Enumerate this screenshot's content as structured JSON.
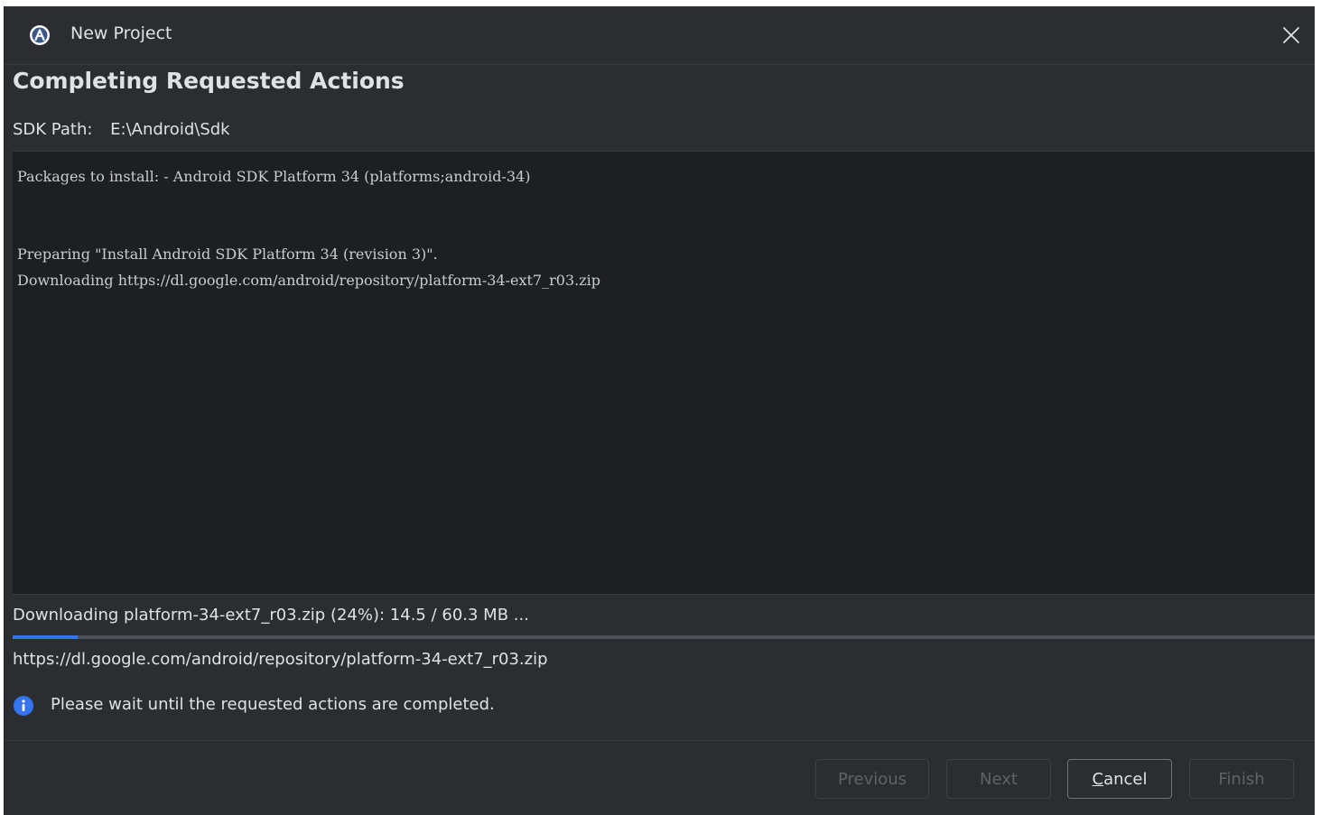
{
  "window": {
    "title": "New Project",
    "app_icon": "android-studio-icon",
    "close_icon": "close-icon"
  },
  "heading": "Completing Requested Actions",
  "sdk": {
    "label": "SDK Path:",
    "value": "E:\\Android\\Sdk"
  },
  "log": {
    "lines": [
      "Packages to install: - Android SDK Platform 34 (platforms;android-34)",
      "Preparing \"Install Android SDK Platform 34 (revision 3)\".",
      "Downloading https://dl.google.com/android/repository/platform-34-ext7_r03.zip"
    ]
  },
  "progress": {
    "status": "Downloading platform-34-ext7_r03.zip (24%): 14.5 / 60.3 MB ...",
    "percent": 5,
    "url": "https://dl.google.com/android/repository/platform-34-ext7_r03.zip"
  },
  "info": {
    "icon": "info-icon",
    "message": "Please wait until the requested actions are completed."
  },
  "buttons": {
    "previous": "Previous",
    "next": "Next",
    "cancel_mnemonic": "C",
    "cancel_rest": "ancel",
    "finish": "Finish"
  },
  "colors": {
    "background": "#2b2d30",
    "log_background": "#1e1f22",
    "accent": "#3574f0",
    "text": "#dfe1e5",
    "disabled_text": "#5f6268"
  }
}
